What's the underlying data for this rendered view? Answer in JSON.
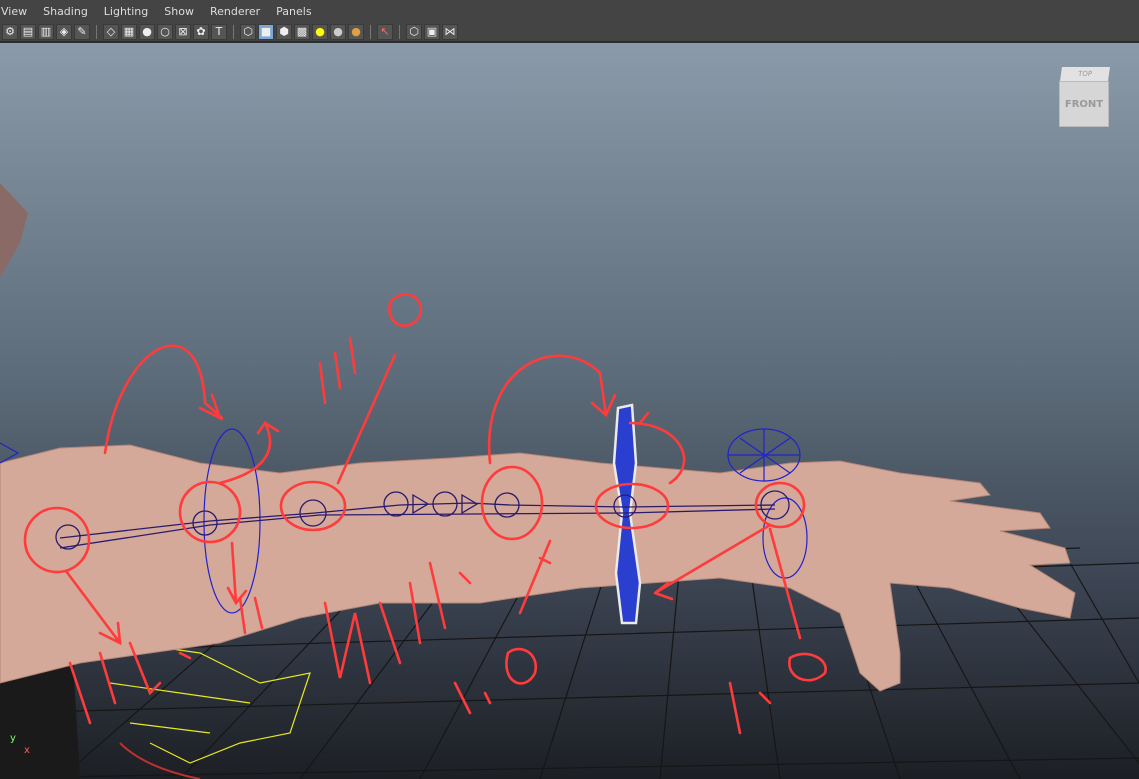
{
  "menu": {
    "items": [
      "View",
      "Shading",
      "Lighting",
      "Show",
      "Renderer",
      "Panels"
    ]
  },
  "toolbar": {
    "icons": [
      "camera-attr-icon",
      "bookmark-icon",
      "film-gate-icon",
      "grid-icon",
      "select-camera-icon",
      "wireframe-icon",
      "smooth-shade-icon",
      "default-light-icon",
      "shadows-icon",
      "xray-icon",
      "textured-icon",
      "wire-cube-icon",
      "shaded-cube-icon",
      "smooth-cube-icon",
      "checker-icon",
      "light-sphere-icon",
      "grey-sphere-icon",
      "gold-sphere-icon",
      "isolate-select-icon",
      "wire-box-icon",
      "frame-box-icon",
      "nodes-icon"
    ]
  },
  "viewcube": {
    "top_label": "TOP",
    "front_label": "FRONT"
  },
  "axis": {
    "y_label": "y",
    "x_label": "x"
  },
  "colors": {
    "annotation": "#ff3b3b",
    "joint": "#2a1a6b",
    "grid": "#1a1a1a",
    "yellow_guide": "#e8e820",
    "blue_ik": "#2222cc"
  }
}
